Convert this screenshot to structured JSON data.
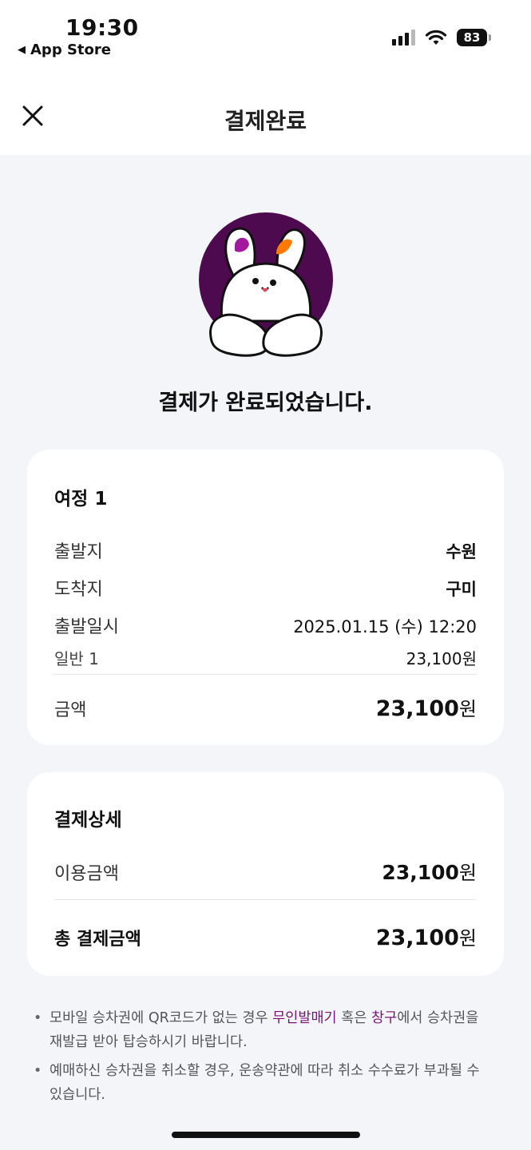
{
  "status": {
    "time": "19:30",
    "back_app": "App Store",
    "battery": "83"
  },
  "nav": {
    "title": "결제완료"
  },
  "message": "결제가 완료되었습니다.",
  "trip": {
    "title": "여정 1",
    "departure_label": "출발지",
    "departure_value": "수원",
    "arrival_label": "도착지",
    "arrival_value": "구미",
    "datetime_label": "출발일시",
    "datetime_value": "2025.01.15 (수) 12:20",
    "fare_label": "일반 1",
    "fare_value": "23,100원",
    "amount_label": "금액",
    "amount_number": "23,100",
    "amount_unit": "원"
  },
  "payment": {
    "title": "결제상세",
    "usage_label": "이용금액",
    "usage_number": "23,100",
    "usage_unit": "원",
    "total_label": "총 결제금액",
    "total_number": "23,100",
    "total_unit": "원"
  },
  "notes": {
    "n1_a": "모바일 승차권에 QR코드가 없는 경우 ",
    "n1_h1": "무인발매기",
    "n1_b": " 혹은 ",
    "n1_h2": "창구",
    "n1_c": "에서 승차권을 재발급 받아 탑승하시기 바랍니다.",
    "n2": "예매하신 승차권을 취소할 경우, 운송약관에 따라 취소 수수료가 부과될 수 있습니다."
  },
  "colors": {
    "accent": "#7a1276",
    "mascot_bg": "#4e0a4e",
    "ear_orange": "#ff7a00",
    "ear_purple": "#a11a9c"
  },
  "icons": [
    "close-icon",
    "signal-icon",
    "wifi-icon",
    "battery-icon",
    "rabbit-mascot"
  ]
}
